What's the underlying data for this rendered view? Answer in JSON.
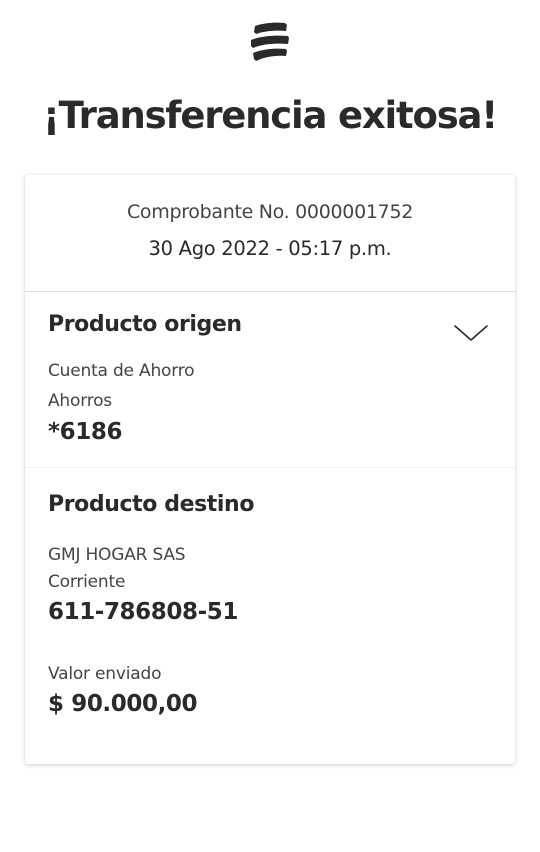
{
  "header": {
    "logo": "bank-logo-icon",
    "title": "¡Transferencia exitosa!"
  },
  "receipt": {
    "number": "Comprobante No. 0000001752",
    "date": "30 Ago 2022 - 05:17 p.m."
  },
  "origin": {
    "title": "Producto origen",
    "account_name": "Cuenta de Ahorro",
    "account_type": "Ahorros",
    "account_number": "*6186",
    "toggle_icon": "chevron-down-icon"
  },
  "destination": {
    "title": "Producto destino",
    "account_name": "GMJ HOGAR SAS",
    "account_type": "Corriente",
    "account_number": "611-786808-51",
    "amount_label": "Valor enviado",
    "amount": "$ 90.000,00"
  },
  "colors": {
    "text": "#2c2a29",
    "secondary_text": "#454545",
    "divider": "#dedede",
    "background": "#ffffff"
  }
}
